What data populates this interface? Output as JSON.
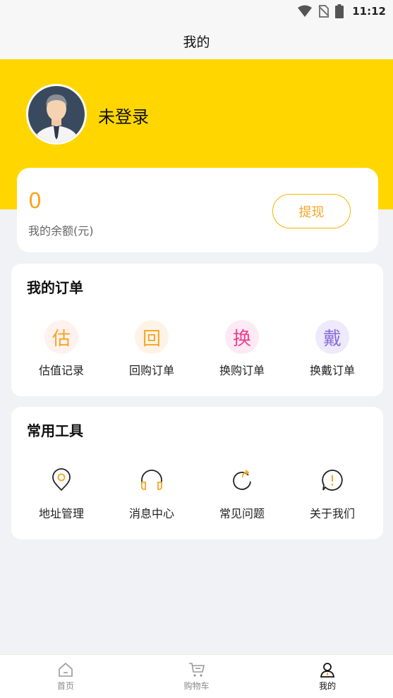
{
  "status_bar": {
    "time": "11:12"
  },
  "header": {
    "title": "我的"
  },
  "profile": {
    "username": "未登录"
  },
  "balance": {
    "amount": "0",
    "label": "我的余额(元)",
    "withdraw_label": "提现"
  },
  "orders": {
    "title": "我的订单",
    "items": [
      {
        "glyph": "估",
        "label": "估值记录",
        "color": "#f5a623",
        "bg": "#fff1ed"
      },
      {
        "glyph": "回",
        "label": "回购订单",
        "color": "#f5a623",
        "bg": "#fff3e8"
      },
      {
        "glyph": "换",
        "label": "换购订单",
        "color": "#f03e8c",
        "bg": "#fdeaf5"
      },
      {
        "glyph": "戴",
        "label": "换戴订单",
        "color": "#8b6fe0",
        "bg": "#eeeafc"
      }
    ]
  },
  "tools": {
    "title": "常用工具",
    "items": [
      {
        "icon": "location-pin-icon",
        "label": "地址管理"
      },
      {
        "icon": "headphones-icon",
        "label": "消息中心"
      },
      {
        "icon": "refresh-icon",
        "label": "常见问题"
      },
      {
        "icon": "exclamation-bubble-icon",
        "label": "关于我们"
      }
    ]
  },
  "tabbar": {
    "tabs": [
      {
        "icon": "home-icon",
        "label": "首页"
      },
      {
        "icon": "cart-icon",
        "label": "购物车"
      },
      {
        "icon": "user-icon",
        "label": "我的"
      }
    ]
  },
  "colors": {
    "accent": "#ffd600",
    "orange": "#f5a623"
  }
}
